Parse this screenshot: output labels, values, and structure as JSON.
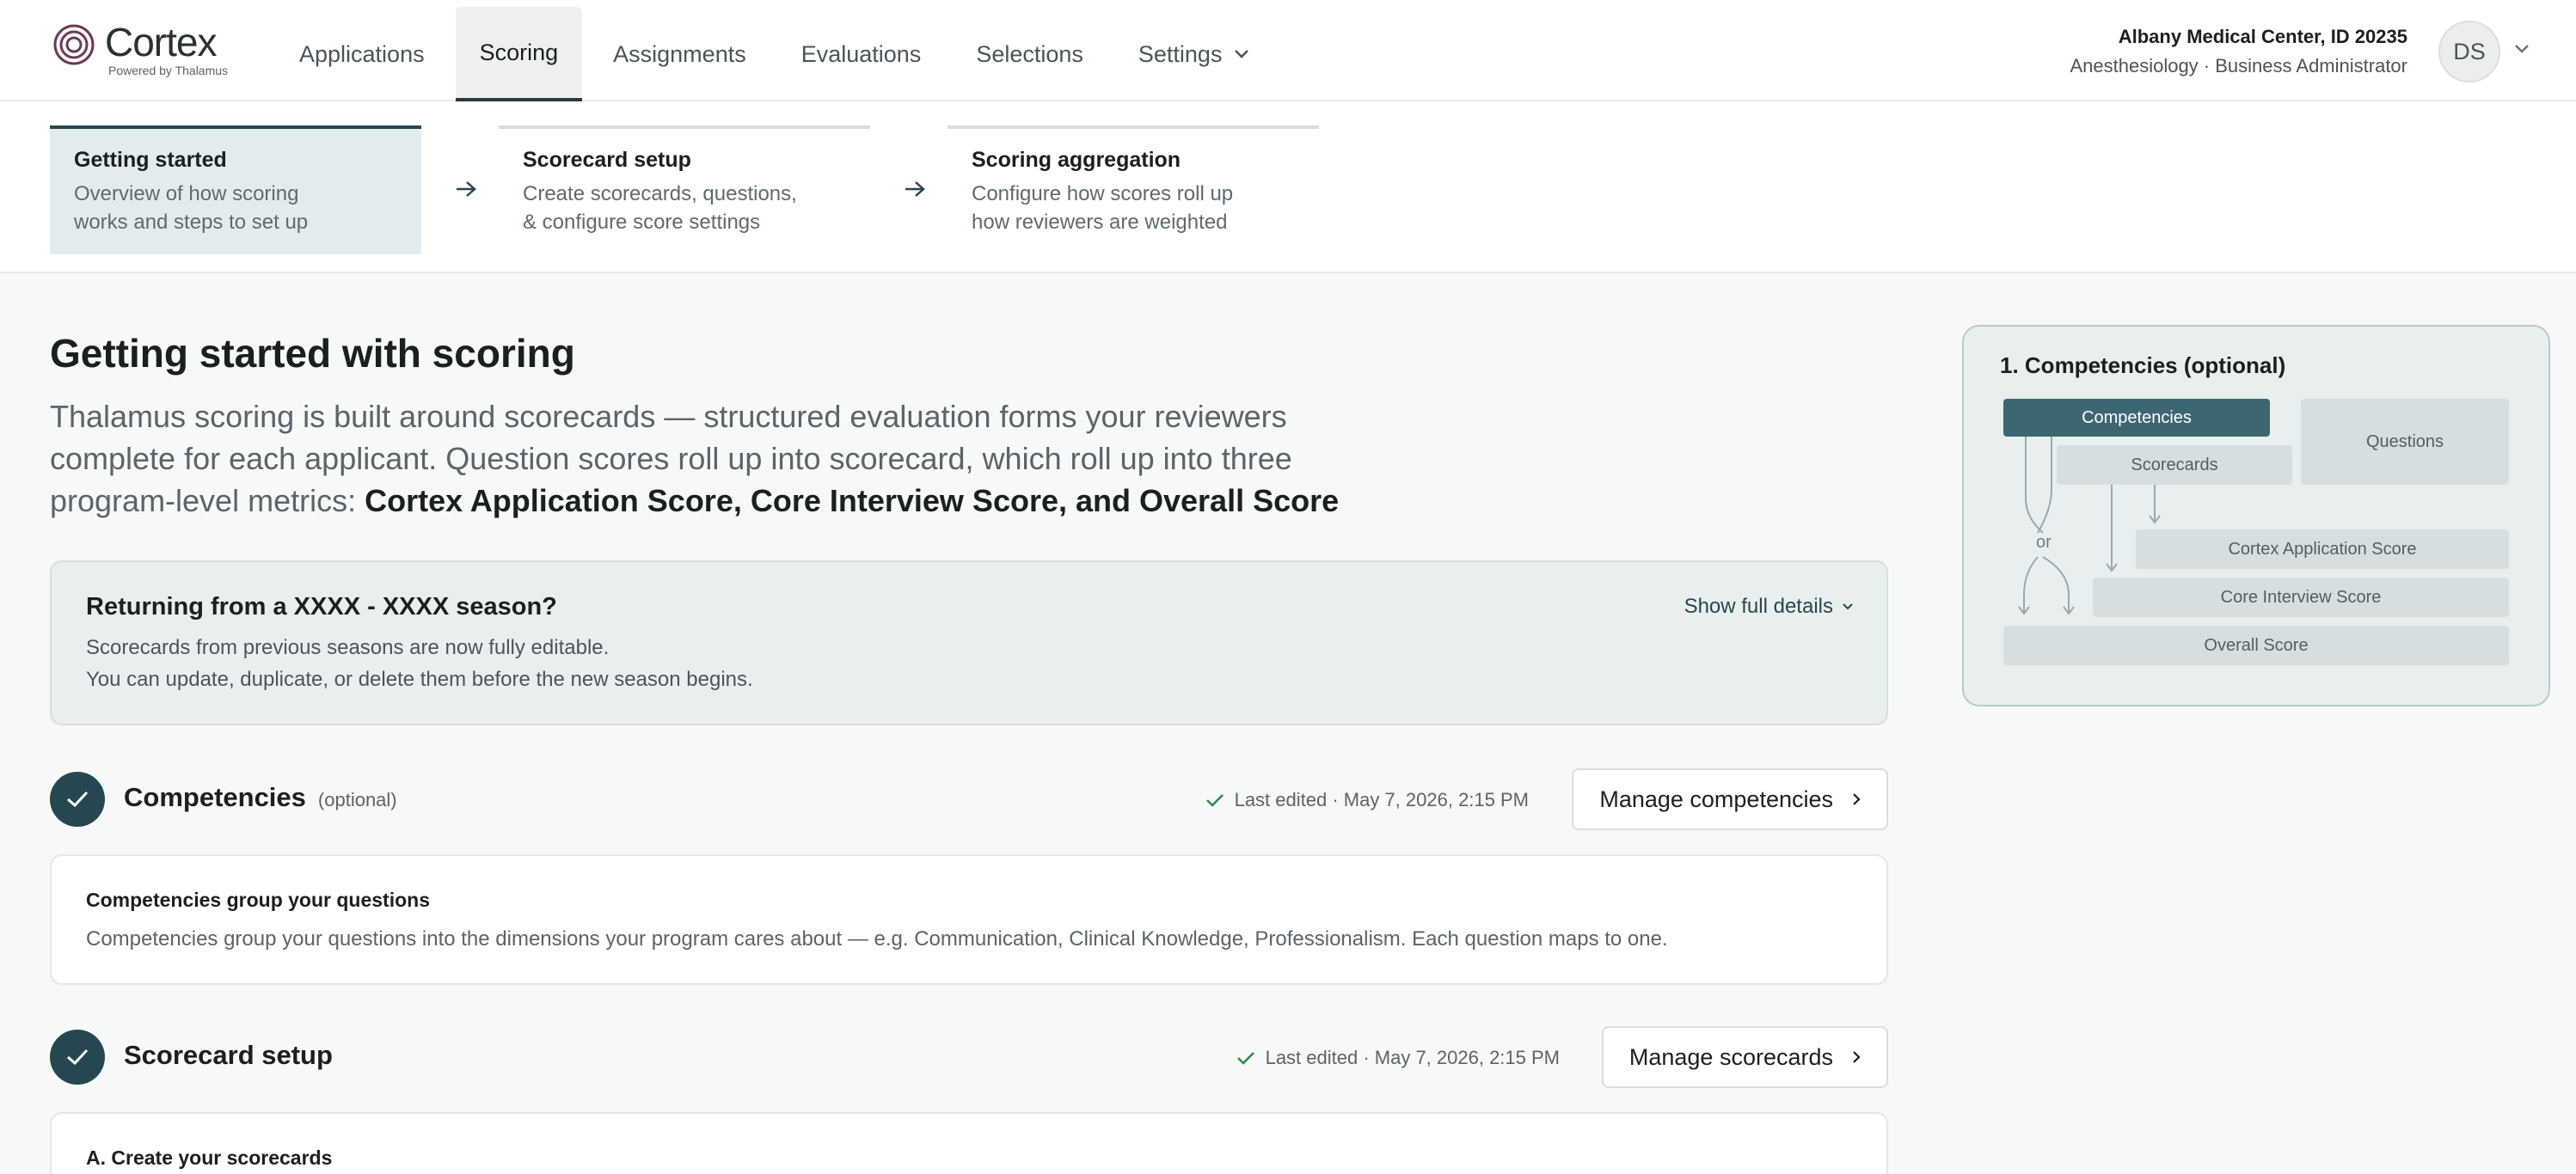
{
  "app": {
    "name": "Cortex",
    "tagline": "Powered by Thalamus"
  },
  "nav": {
    "items": [
      {
        "label": "Applications",
        "active": false
      },
      {
        "label": "Scoring",
        "active": true
      },
      {
        "label": "Assignments",
        "active": false
      },
      {
        "label": "Evaluations",
        "active": false
      },
      {
        "label": "Selections",
        "active": false
      },
      {
        "label": "Settings",
        "active": false
      }
    ]
  },
  "user": {
    "org": "Albany Medical Center, ID 20235",
    "role": "Anesthesiology · Business Administrator",
    "initials": "DS"
  },
  "stepper": {
    "steps": [
      {
        "title": "Getting started",
        "desc": "Overview of how scoring\nworks and steps to set up",
        "active": true
      },
      {
        "title": "Scorecard setup",
        "desc": "Create scorecards, questions,\n& configure score settings",
        "active": false
      },
      {
        "title": "Scoring aggregation",
        "desc": "Configure how scores roll up\nhow reviewers are weighted",
        "active": false
      }
    ]
  },
  "main": {
    "title": "Getting started with scoring",
    "intro_text": "Thalamus scoring is built around scorecards — structured evaluation forms your reviewers complete for each applicant. Question scores roll up into scorecard, which roll up into three program-level metrics: ",
    "intro_bold": "Cortex Application Score, Core Interview Score, and Overall Score"
  },
  "banner": {
    "title": "Returning from a XXXX - XXXX season?",
    "line1": "Scorecards from previous seasons are now fully editable.",
    "line2": "You can update, duplicate, or delete them before the new season begins.",
    "link": "Show full details"
  },
  "competencies": {
    "title": "Competencies",
    "optional": "(optional)",
    "edited": "Last edited · May 7, 2026, 2:15 PM",
    "button": "Manage competencies",
    "card_title": "Competencies group your questions",
    "card_text": "Competencies group your questions into the dimensions your program cares about — e.g. Communication, Clinical Knowledge, Professionalism. Each question maps to one."
  },
  "scorecard": {
    "title": "Scorecard setup",
    "edited": "Last edited · May 7, 2026, 2:15 PM",
    "button": "Manage scorecards",
    "card_title": "A. Create your scorecards"
  },
  "diagram": {
    "title": "1. Competencies (optional)",
    "competencies": "Competencies",
    "scorecards": "Scorecards",
    "questions": "Questions",
    "or": "or",
    "cortex_score": "Cortex Application Score",
    "interview_score": "Core Interview Score",
    "overall_score": "Overall Score"
  },
  "colors": {
    "accent": "#26474f",
    "diagram_highlight": "#3d6770",
    "banner_bg": "#e9efef",
    "success_check": "#2f8a4e"
  }
}
